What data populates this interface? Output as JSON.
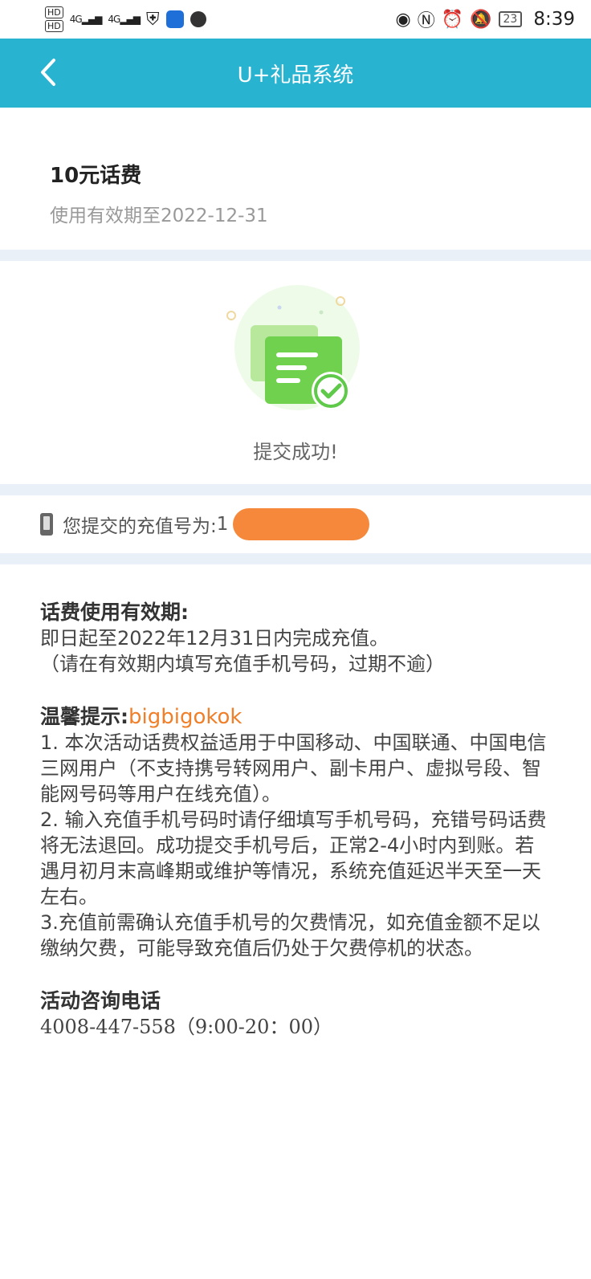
{
  "status_bar": {
    "left_badges": [
      "HD",
      "HD"
    ],
    "signal_labels": [
      "4G",
      "4G"
    ],
    "battery": "23",
    "time": "8:39",
    "icons": [
      "signal-icon",
      "shield-icon",
      "cloud-app-icon",
      "globe-icon",
      "eye-icon",
      "nfc-icon",
      "alarm-icon",
      "bell-off-icon",
      "battery-icon"
    ]
  },
  "header": {
    "title": "U+礼品系统",
    "back_icon": "chevron-left-icon",
    "background": "#28b3d1"
  },
  "gift": {
    "name": "10元话费",
    "validity": "使用有效期至2022-12-31"
  },
  "result": {
    "message": "提交成功!",
    "illustration": "document-check-icon",
    "accent_color": "#5fc94a"
  },
  "submission": {
    "label": "您提交的充值号为: ",
    "number_visible": "1",
    "mask_color": "#f5883a"
  },
  "info": {
    "validity_title": "话费使用有效期:",
    "validity_line1": "即日起至2022年12月31日内完成充值。",
    "validity_line2": "（请在有效期内填写充值手机号码，过期不逾）",
    "tips_title": "温馨提示:",
    "tips_watermark": "bigbigokok",
    "tips": [
      "1. 本次活动话费权益适用于中国移动、中国联通、中国电信三网用户（不支持携号转网用户、副卡用户、虚拟号段、智能网号码等用户在线充值）。",
      "2. 输入充值手机号码时请仔细填写手机号码，充错号码话费将无法退回。成功提交手机号后，正常2-4小时内到账。若遇月初月末高峰期或维护等情况，系统充值延迟半天至一天左右。",
      "3.充值前需确认充值手机号的欠费情况，如充值金额不足以缴纳欠费，可能导致充值后仍处于欠费停机的状态。"
    ],
    "contact_title": "活动咨询电话",
    "contact_phone": "4008-447-558（9:00-20：00）"
  }
}
